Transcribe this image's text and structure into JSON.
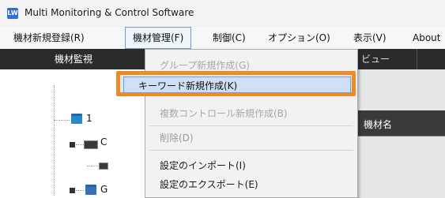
{
  "window": {
    "title": "Multi Monitoring & Control Software",
    "app_icon_text": "LW"
  },
  "menubar": {
    "items": [
      {
        "label": "機材新規登録(R)",
        "active": false
      },
      {
        "label": "機材管理(F)",
        "active": true
      },
      {
        "label": "制御(C)",
        "active": false
      },
      {
        "label": "オプション(O)",
        "active": false
      },
      {
        "label": "表示(V)",
        "active": false
      },
      {
        "label": "About",
        "active": false
      }
    ]
  },
  "tabs": {
    "monitor": "機材監視",
    "view": "ビュー"
  },
  "tree": {
    "nodes": [
      {
        "label": "1"
      },
      {
        "label": "C"
      },
      {
        "label": ""
      },
      {
        "label": "G"
      }
    ]
  },
  "grid": {
    "column_header": "機材名"
  },
  "dropdown": {
    "items": [
      {
        "label": "グループ新規作成(G)",
        "state": "faded"
      },
      {
        "label": "キーワード新規作成(K)",
        "state": "highlighted"
      },
      {
        "label": "複数コントロール新規作成(B)",
        "state": "faded"
      },
      {
        "label": "削除(D)",
        "state": "disabled"
      },
      {
        "label": "設定のインポート(I)",
        "state": "normal"
      },
      {
        "label": "設定のエクスポート(E)",
        "state": "normal"
      }
    ]
  },
  "colors": {
    "highlight_border": "#f08a24",
    "selection": "#cfe0f6"
  }
}
